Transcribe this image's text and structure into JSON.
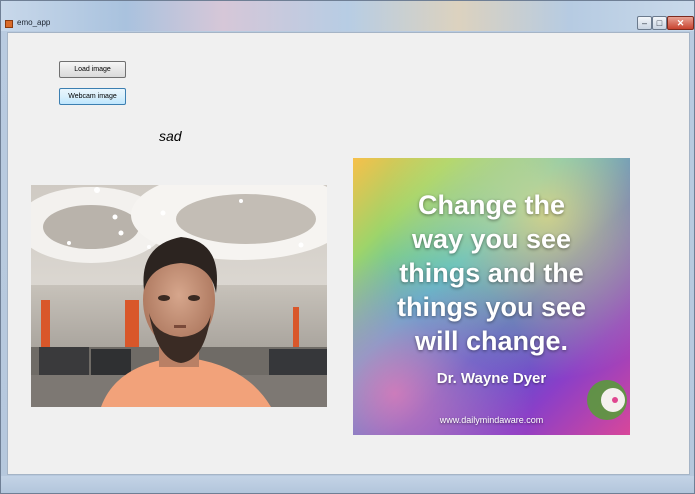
{
  "window": {
    "title": "emo_app",
    "minimize_glyph": "–",
    "maximize_glyph": "□",
    "close_glyph": "✕"
  },
  "buttons": {
    "load_label": "Load image",
    "webcam_label": "Webcam image"
  },
  "result": {
    "emotion": "sad"
  },
  "quote": {
    "lines": [
      "Change the",
      "way you see",
      "things and the",
      "things you see",
      "will change."
    ],
    "author": "Dr. Wayne Dyer",
    "url": "www.dailymindaware.com"
  },
  "colors": {
    "client_bg": "#f0f0f0",
    "accent_button_border": "#3c7fb1",
    "shirt": "#f2a27a"
  },
  "icons": [
    "app-icon",
    "minimize-icon",
    "maximize-icon",
    "close-icon",
    "mind-aware-logo-icon"
  ]
}
